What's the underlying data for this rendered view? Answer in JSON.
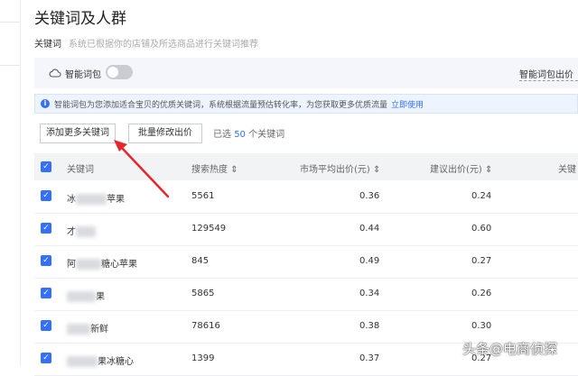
{
  "page": {
    "title": "关键词及人群",
    "section_label": "关键词",
    "section_desc": "系统已根据你的店铺及所选商品进行关键词推荐"
  },
  "smart_bid": {
    "label": "智能词包",
    "right_label": "智能词包出价（"
  },
  "info": {
    "text": "智能词包为您添加适合宝贝的优质关键词，系统根据流量预估转化率，为您获取更多优质流量",
    "link": "立即使用"
  },
  "toolbar": {
    "add_button": "添加更多关键词",
    "batch_button": "批量修改出价",
    "selected_prefix": "已选",
    "selected_count": "50",
    "selected_suffix": "个关键词"
  },
  "table": {
    "columns": {
      "keyword": "关键词",
      "heat": "搜索热度",
      "market_bid": "市场平均出价(元)",
      "suggest_bid": "建议出价(元)",
      "more": "关键"
    },
    "rows": [
      {
        "kw_pre": "冰",
        "kw_post": "苹果",
        "heat": "5561",
        "market": "0.36",
        "suggest": "0.24"
      },
      {
        "kw_pre": "才",
        "kw_post": "",
        "heat": "129549",
        "market": "0.44",
        "suggest": "0.60"
      },
      {
        "kw_pre": "阿",
        "kw_post": "糖心苹果",
        "heat": "845",
        "market": "0.49",
        "suggest": "0.27"
      },
      {
        "kw_pre": "",
        "kw_post": "果",
        "heat": "5865",
        "market": "0.34",
        "suggest": "0.26"
      },
      {
        "kw_pre": "",
        "kw_post": "新鲜",
        "heat": "78616",
        "market": "0.38",
        "suggest": "0.30"
      },
      {
        "kw_pre": "",
        "kw_post": "果冰糖心",
        "heat": "1399",
        "market": "0.37",
        "suggest": "0.27"
      }
    ]
  },
  "watermark": "头条@电商侦探",
  "colors": {
    "accent": "#3370ff",
    "arrow": "#e8252a"
  }
}
